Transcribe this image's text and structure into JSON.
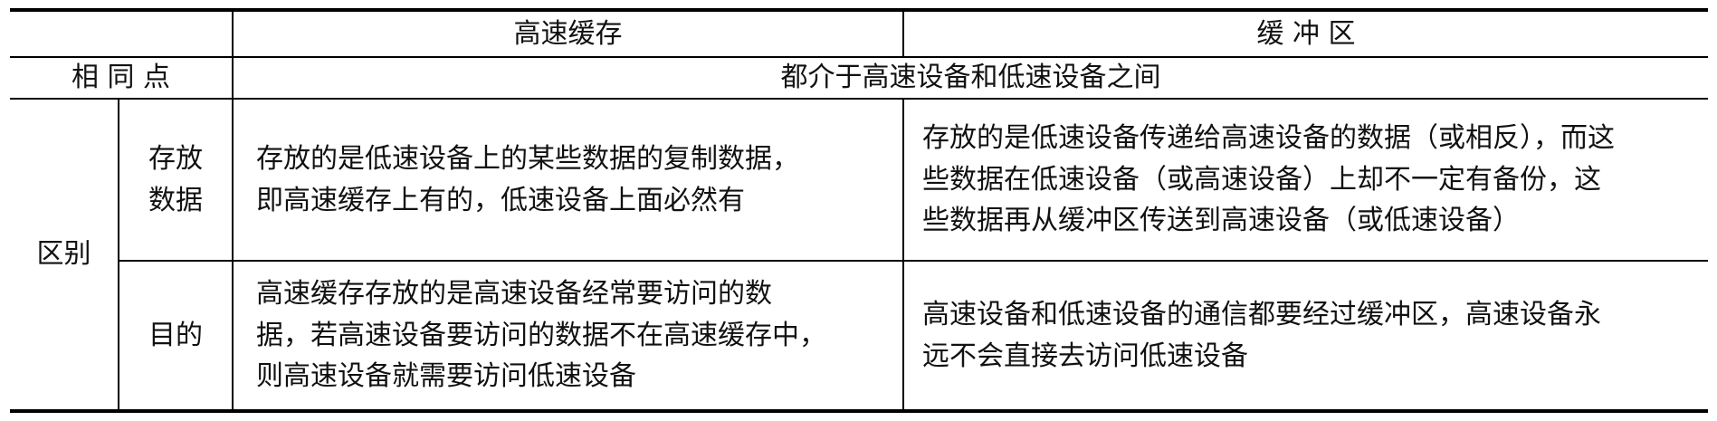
{
  "table": {
    "header": {
      "cache": "高速缓存",
      "buffer": "缓 冲 区"
    },
    "same": {
      "label": "相 同 点",
      "content": "都介于高速设备和低速设备之间"
    },
    "difference": {
      "label": "区别",
      "storage": {
        "label": "存放\n数据",
        "cache": "存放的是低速设备上的某些数据的复制数据，\n即高速缓存上有的，低速设备上面必然有",
        "buffer": "存放的是低速设备传递给高速设备的数据（或相反），而这\n些数据在低速设备（或高速设备）上却不一定有备份，这\n些数据再从缓冲区传送到高速设备（或低速设备）"
      },
      "purpose": {
        "label": "目的",
        "cache": "高速缓存存放的是高速设备经常要访问的数\n据，若高速设备要访问的数据不在高速缓存中，\n则高速设备就需要访问低速设备",
        "buffer": "高速设备和低速设备的通信都要经过缓冲区，高速设备永\n远不会直接去访问低速设备"
      }
    }
  }
}
